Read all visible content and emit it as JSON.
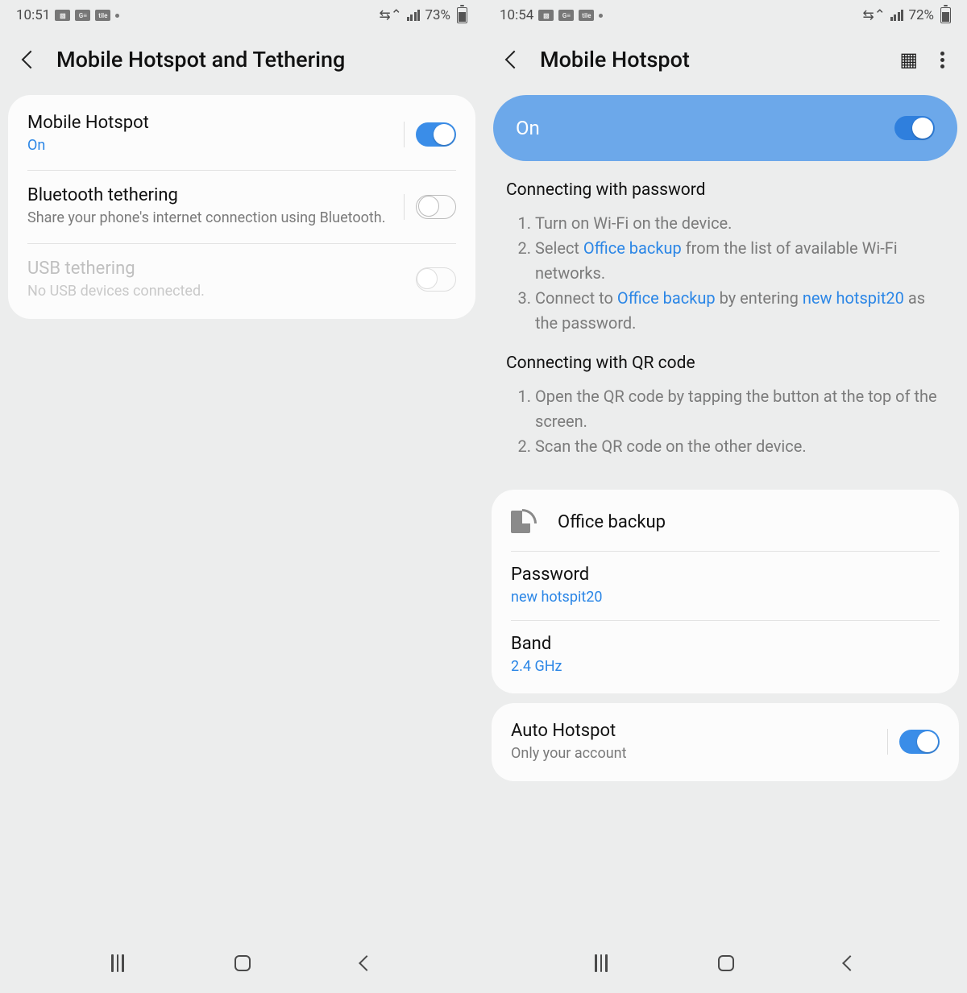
{
  "left": {
    "status": {
      "time": "10:51",
      "battery": "73%"
    },
    "header": {
      "title": "Mobile Hotspot and Tethering"
    },
    "rows": {
      "hotspot": {
        "title": "Mobile Hotspot",
        "sub": "On",
        "on": true
      },
      "bluetooth": {
        "title": "Bluetooth tethering",
        "sub": "Share your phone's internet connection using Bluetooth.",
        "on": false
      },
      "usb": {
        "title": "USB tethering",
        "sub": "No USB devices connected.",
        "disabled": true
      }
    }
  },
  "right": {
    "status": {
      "time": "10:54",
      "battery": "72%"
    },
    "header": {
      "title": "Mobile Hotspot"
    },
    "onbar": {
      "label": "On",
      "on": true
    },
    "password_section": {
      "title": "Connecting with password",
      "step1": "Turn on Wi-Fi on the device.",
      "step2_a": "Select ",
      "step2_link": "Office backup",
      "step2_b": " from the list of available Wi-Fi networks.",
      "step3_a": "Connect to ",
      "step3_link1": "Office backup",
      "step3_b": " by entering ",
      "step3_link2": "new hotspit20",
      "step3_c": " as the password."
    },
    "qr_section": {
      "title": "Connecting with QR code",
      "step1": "Open the QR code by tapping the button at the top of the screen.",
      "step2": "Scan the QR code on the other device."
    },
    "network": {
      "name": "Office backup",
      "password_label": "Password",
      "password_value": "new hotspit20",
      "band_label": "Band",
      "band_value": "2.4 GHz"
    },
    "auto": {
      "title": "Auto Hotspot",
      "sub": "Only your account",
      "on": true
    }
  }
}
